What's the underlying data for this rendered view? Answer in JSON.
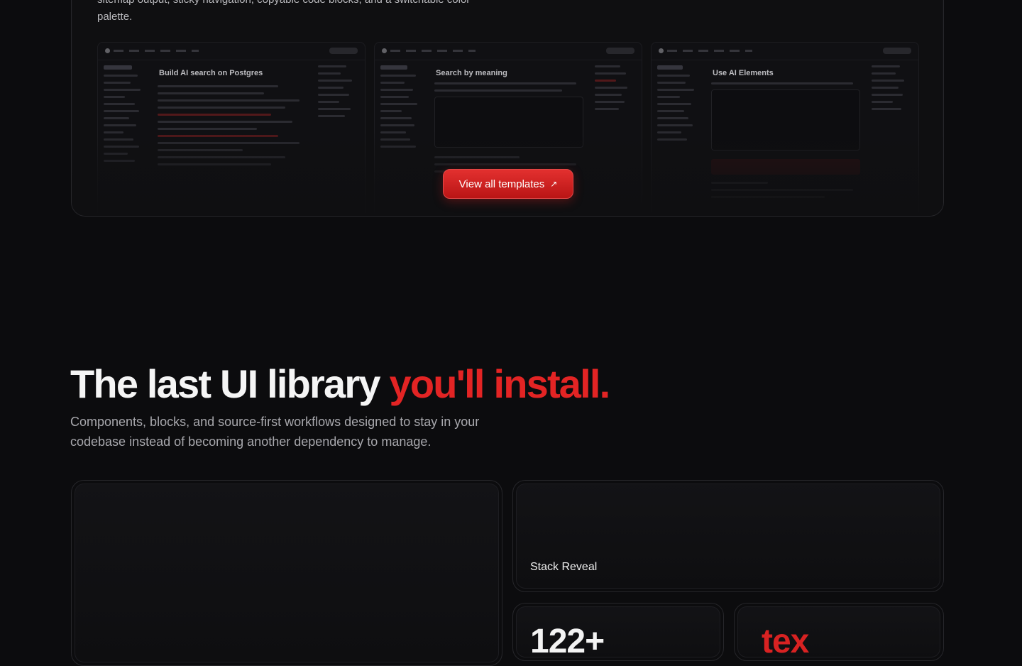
{
  "templates": {
    "intro_line1": "sitemap output, sticky navigation, copyable code blocks, and a switchable color",
    "intro_line2": "palette.",
    "thumb_titles": [
      "Build AI search on Postgres",
      "Search by meaning",
      "Use AI Elements"
    ],
    "cta_label": "View all templates",
    "cta_icon": "arrow-up-right-icon"
  },
  "hero": {
    "title_main": "The last UI library ",
    "title_accent": "you'll install.",
    "subtitle": "Components, blocks, and source-first workflows designed to stay in your codebase instead of becoming another dependency to manage."
  },
  "cards": {
    "stack_label": "Stack Reveal",
    "count_value": "122+",
    "tex_value": "tex"
  },
  "colors": {
    "accent": "#e32424",
    "background": "#0c0c0e",
    "card_border": "#26262a"
  }
}
